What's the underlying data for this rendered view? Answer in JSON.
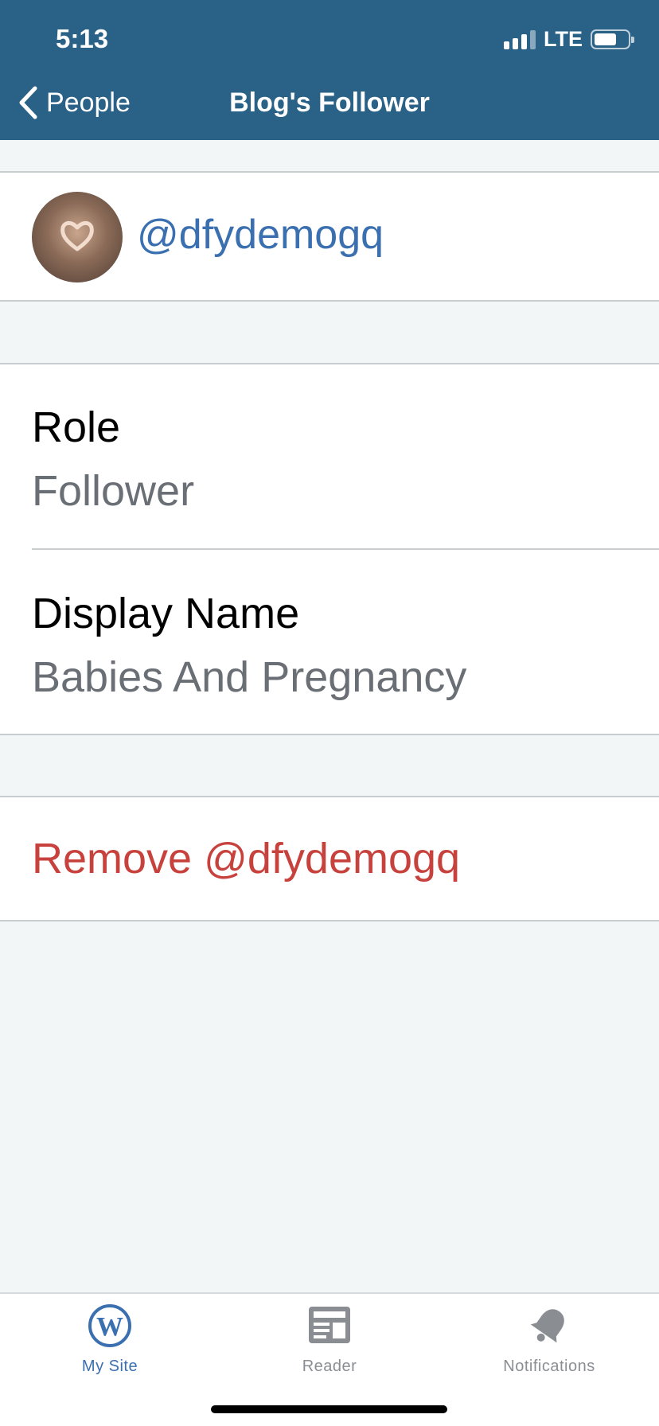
{
  "status_bar": {
    "time": "5:13",
    "network": "LTE",
    "battery_level": 0.68
  },
  "nav": {
    "back_label": "People",
    "title": "Blog's Follower"
  },
  "user": {
    "username": "@dfydemogq"
  },
  "details": {
    "role_label": "Role",
    "role_value": "Follower",
    "display_name_label": "Display Name",
    "display_name_value": "Babies And Pregnancy"
  },
  "actions": {
    "remove_label": "Remove @dfydemogq"
  },
  "tabbar": {
    "tabs": [
      {
        "label": "My Site",
        "icon": "wordpress-icon",
        "active": true
      },
      {
        "label": "Reader",
        "icon": "reader-icon",
        "active": false
      },
      {
        "label": "Notifications",
        "icon": "bell-icon",
        "active": false
      }
    ]
  },
  "colors": {
    "header_bg": "#2a6287",
    "link_blue": "#3a6fb0",
    "destructive_red": "#c8423d",
    "secondary_text": "#6a6e75",
    "page_bg": "#f3f6f6"
  }
}
